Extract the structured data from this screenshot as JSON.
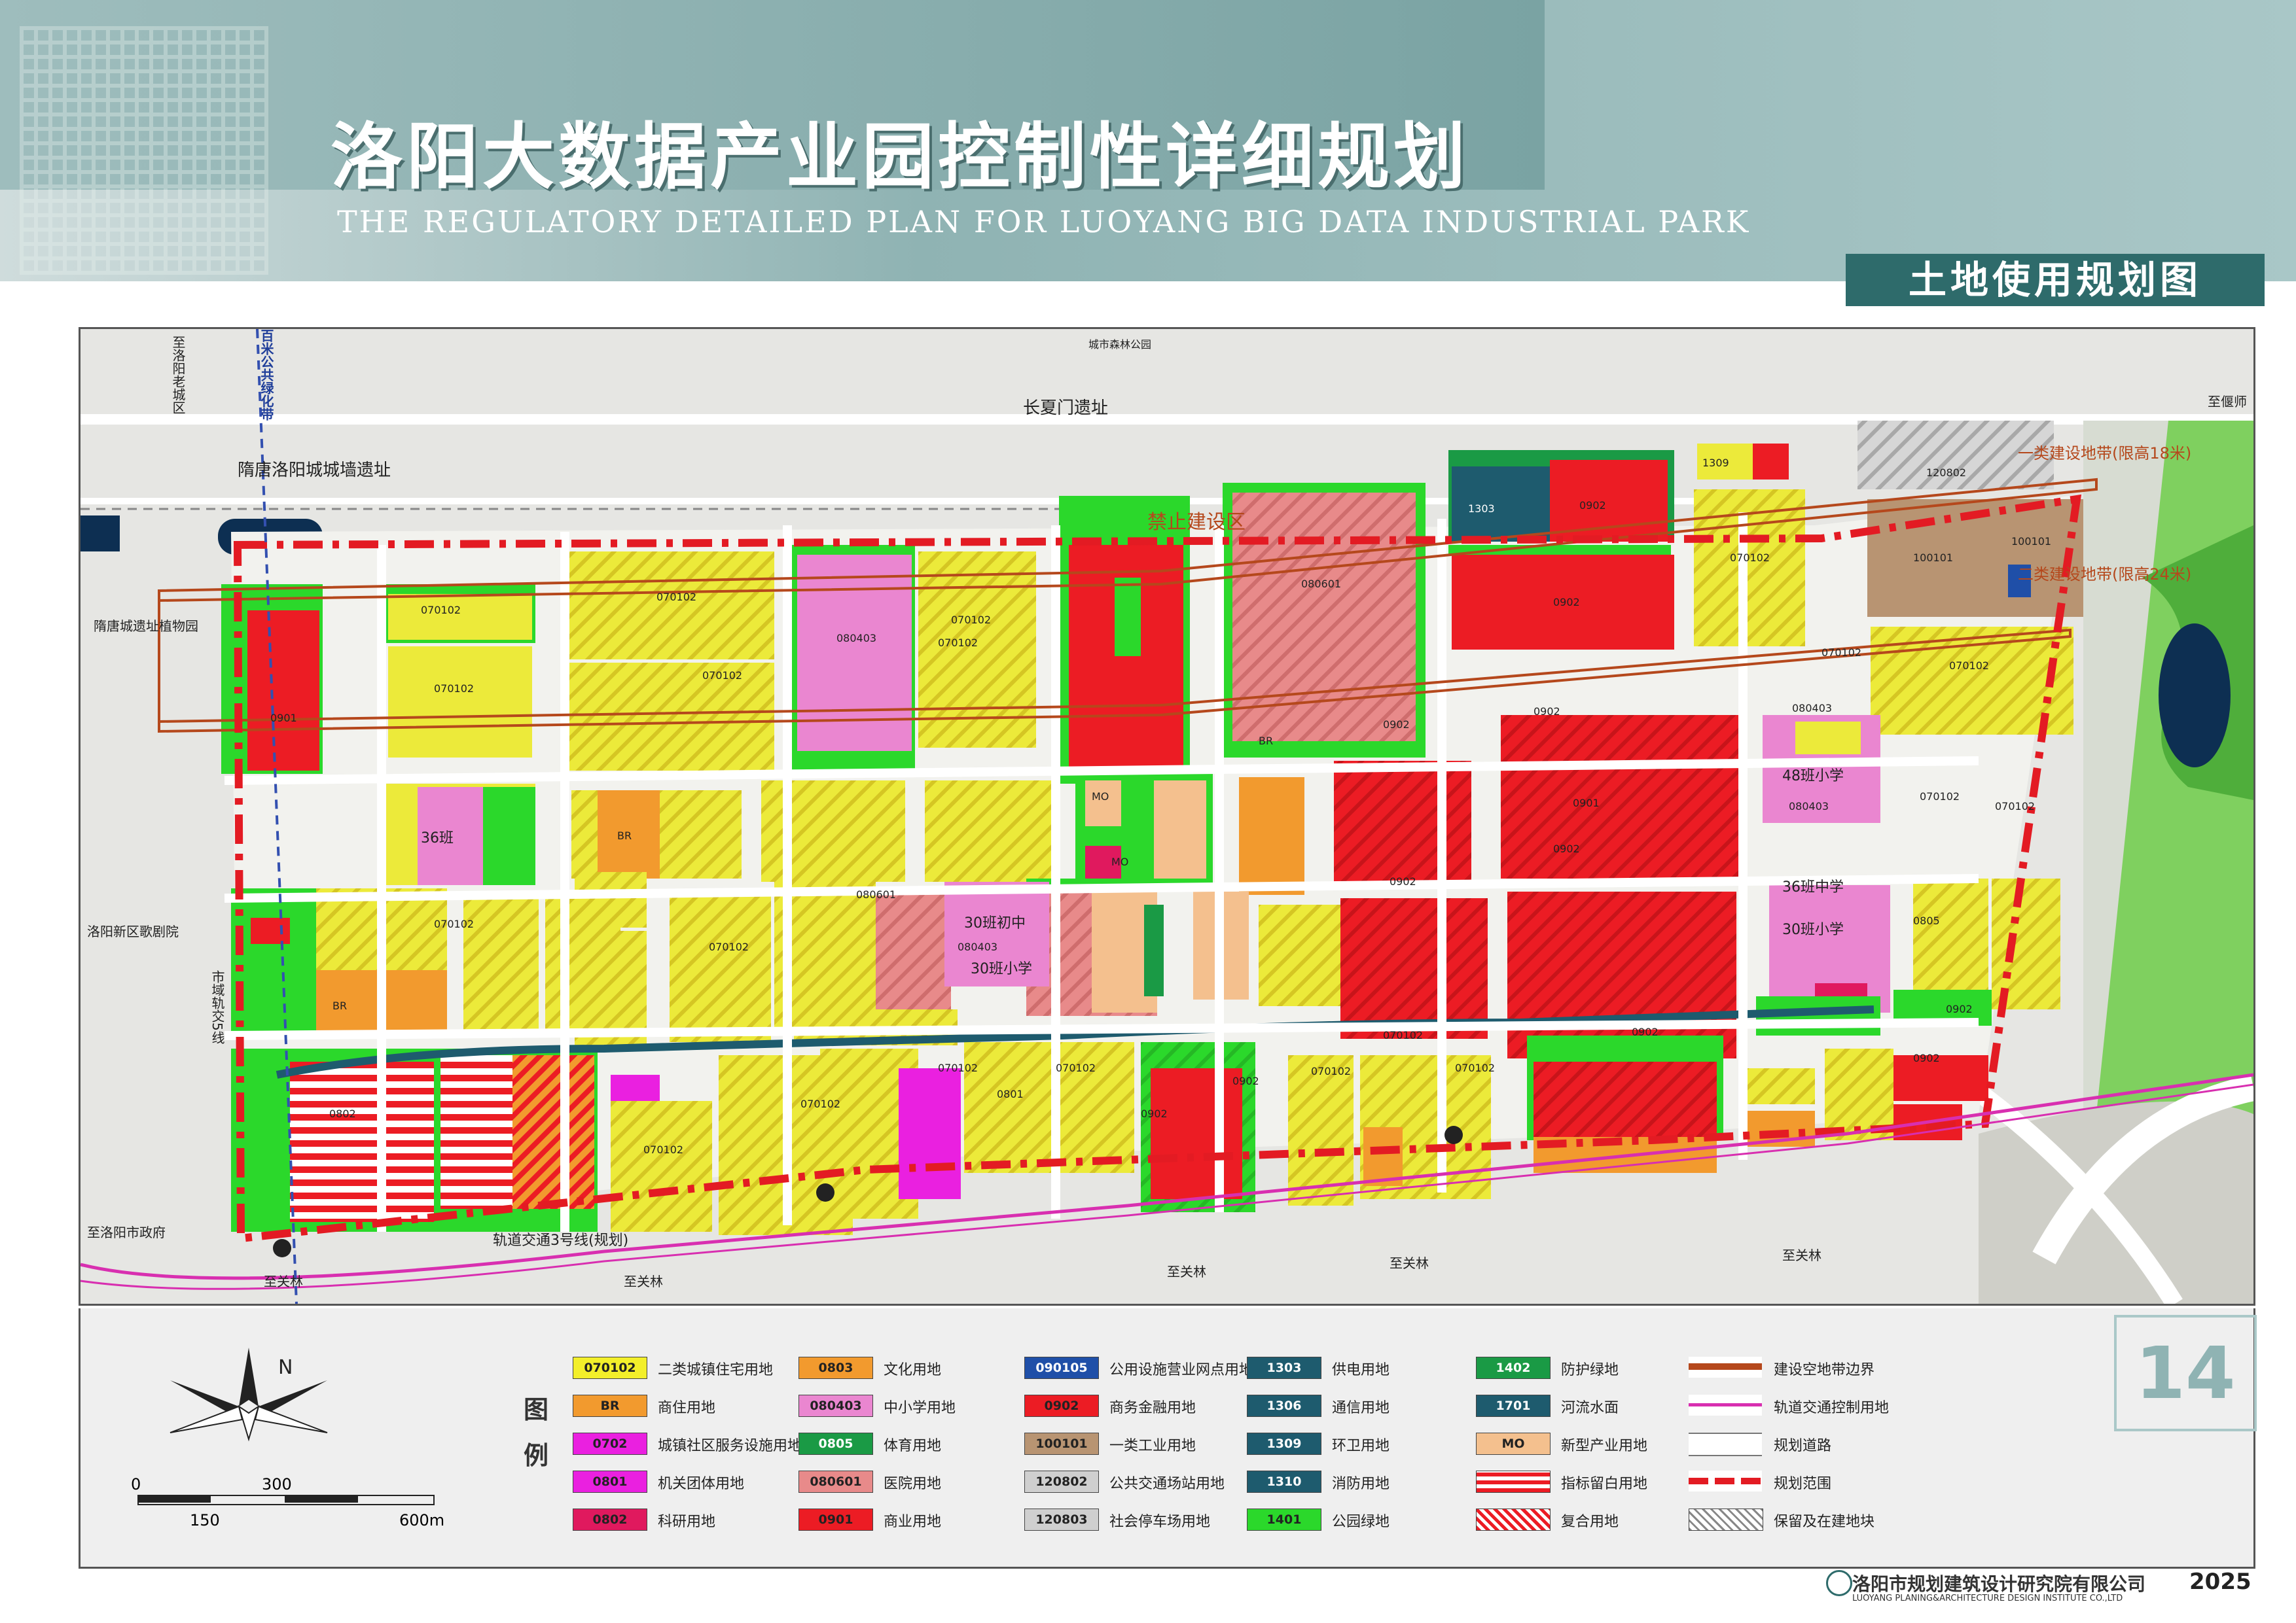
{
  "header": {
    "title_cn": "洛阳大数据产业园控制性详细规划",
    "title_en": "THE REGULATORY DETAILED PLAN FOR LUOYANG BIG DATA INDUSTRIAL PARK",
    "subtitle": "土地使用规划图"
  },
  "page_number": "14",
  "year": "2025",
  "org": {
    "cn": "洛阳市规划建筑设计研究院有限公司",
    "en": "LUOYANG PLANING&ARCHITECTURE DESIGN INSTITUTE CO.,LTD"
  },
  "map_labels": {
    "wall_ruins": "隋唐洛阳城城墙遗址",
    "changxia_gate": "长夏门遗址",
    "forbidden_zone": "禁止建设区",
    "sui_tang_garden": "隋唐城遗址植物园",
    "luoyang_old_city": "至洛阳老城区",
    "to_gov": "至洛阳市政府",
    "to_guanlin_1": "至关林",
    "to_guanlin_2": "至关林",
    "to_guanlin_3": "至关林",
    "to_guanlin_4": "至关林",
    "to_guanlin_5": "至关林",
    "metro_line": "轨道交通3号线(规划)",
    "metro_line2": "市域轨交5线",
    "height_zone_1": "一类建设地带(限高18米)",
    "height_zone_2": "二类建设地带(限高24米)",
    "school_48": "48班小学",
    "school_36": "36班中学",
    "school_30": "30班小学",
    "school_30b": "30班初中",
    "school_30c": "30班小学",
    "school_36b": "36班",
    "opera": "洛阳新区歌剧院",
    "city_forest_park": "城市森林公园",
    "greenway": "百米公共绿化带",
    "zhi_yu": "至偃师"
  },
  "colors": {
    "residential": "#ecea3a",
    "residential_stripe": "#d9c21a",
    "commercial_finance": "#ec1c24",
    "commercial_stripe": "#b40f14",
    "green": "#2bd82b",
    "hospital": "#e88a8a",
    "school": "#ea86d0",
    "business": "#f29a2e",
    "industry": "#b89472",
    "newtype": "#f4c08e",
    "parking": "#cfcfcf",
    "water": "#0d2f52",
    "protect_green": "#1a9a45",
    "office": "#ea20e0",
    "boundary": "#e31b23"
  },
  "land_blocks": [
    {
      "code": "0901",
      "use": "commercial"
    },
    {
      "code": "070102",
      "use": "residential"
    },
    {
      "code": "080403",
      "use": "school"
    },
    {
      "code": "080601",
      "use": "hospital"
    },
    {
      "code": "0902",
      "use": "commercial"
    },
    {
      "code": "BR",
      "use": "business"
    },
    {
      "code": "MO",
      "use": "newtype"
    },
    {
      "code": "100101",
      "use": "industry"
    },
    {
      "code": "120802",
      "use": "parking"
    },
    {
      "code": "1303",
      "use": "utility"
    },
    {
      "code": "1309",
      "use": "utility"
    },
    {
      "code": "0805",
      "use": "sports"
    },
    {
      "code": "0801",
      "use": "office"
    },
    {
      "code": "0802",
      "use": "research"
    }
  ],
  "legend": {
    "title": "图例",
    "items": [
      {
        "code": "070102",
        "label": "二类城镇住宅用地",
        "color": "#f3ef2a"
      },
      {
        "code": "BR",
        "label": "商住用地",
        "color": "#f29a2e"
      },
      {
        "code": "0702",
        "label": "城镇社区服务设施用地",
        "color": "#ea20e0"
      },
      {
        "code": "0801",
        "label": "机关团体用地",
        "color": "#ea20e0"
      },
      {
        "code": "0802",
        "label": "科研用地",
        "color": "#e0195e"
      },
      {
        "code": "0803",
        "label": "文化用地",
        "color": "#f29a2e"
      },
      {
        "code": "080403",
        "label": "中小学用地",
        "color": "#ea86d0"
      },
      {
        "code": "0805",
        "label": "体育用地",
        "color": "#1a9a45"
      },
      {
        "code": "080601",
        "label": "医院用地",
        "color": "#e88a8a"
      },
      {
        "code": "0901",
        "label": "商业用地",
        "color": "#ec1c24"
      },
      {
        "code": "090105",
        "label": "公用设施营业网点用地",
        "color": "#1f4fa8"
      },
      {
        "code": "0902",
        "label": "商务金融用地",
        "color": "#ec1c24"
      },
      {
        "code": "100101",
        "label": "一类工业用地",
        "color": "#b89472"
      },
      {
        "code": "120802",
        "label": "公共交通场站用地",
        "color": "#cfcfcf"
      },
      {
        "code": "120803",
        "label": "社会停车场用地",
        "color": "#cfcfcf"
      },
      {
        "code": "1303",
        "label": "供电用地",
        "color": "#1e5b6e"
      },
      {
        "code": "1306",
        "label": "通信用地",
        "color": "#1e5b6e"
      },
      {
        "code": "1309",
        "label": "环卫用地",
        "color": "#1e5b6e"
      },
      {
        "code": "1310",
        "label": "消防用地",
        "color": "#1e5b6e"
      },
      {
        "code": "1401",
        "label": "公园绿地",
        "color": "#2bd82b"
      },
      {
        "code": "1402",
        "label": "防护绿地",
        "color": "#1a9a45"
      },
      {
        "code": "1701",
        "label": "河流水面",
        "color": "#1e5b6e"
      },
      {
        "code": "MO",
        "label": "新型产业用地",
        "color": "#f4c08e"
      },
      {
        "code": "",
        "label": "指标留白用地",
        "color": "stripe-red"
      },
      {
        "code": "",
        "label": "复合用地",
        "color": "stripe-pink"
      },
      {
        "code": "",
        "label": "建设空地带边界",
        "color": "line-brown"
      },
      {
        "code": "",
        "label": "轨道交通控制用地",
        "color": "line-magenta"
      },
      {
        "code": "",
        "label": "规划道路",
        "color": "road"
      },
      {
        "code": "",
        "label": "规划范围",
        "color": "dash-red"
      },
      {
        "code": "",
        "label": "保留及在建地块",
        "color": "hatch-gray"
      }
    ]
  },
  "scale": {
    "ticks": [
      "0",
      "150",
      "300",
      "600m"
    ]
  },
  "compass_letter": "N"
}
